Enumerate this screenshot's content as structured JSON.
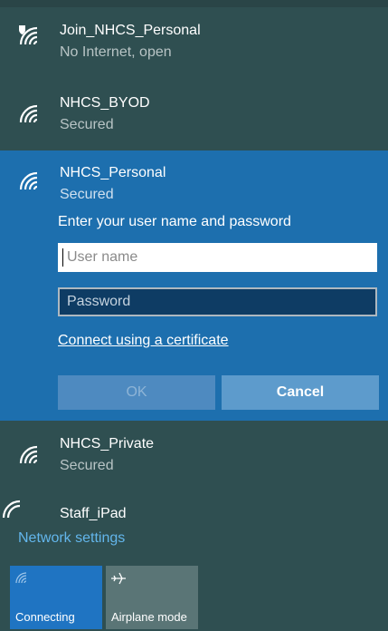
{
  "networks": [
    {
      "name": "Join_NHCS_Personal",
      "status": "No Internet, open",
      "icon": "wifi-shield-icon"
    },
    {
      "name": "NHCS_BYOD",
      "status": "Secured",
      "icon": "wifi-icon"
    },
    {
      "name": "NHCS_Personal",
      "status": "Secured",
      "icon": "wifi-icon"
    },
    {
      "name": "NHCS_Private",
      "status": "Secured",
      "icon": "wifi-icon"
    },
    {
      "name": "Staff_iPad",
      "status": "",
      "icon": "wifi-icon"
    }
  ],
  "login": {
    "prompt": "Enter your user name and password",
    "username_placeholder": "User name",
    "username_value": "",
    "password_placeholder": "Password",
    "password_value": "",
    "cert_link": "Connect using a certificate",
    "ok_label": "OK",
    "cancel_label": "Cancel"
  },
  "footer": {
    "settings_link": "Network settings",
    "tiles": [
      {
        "label": "Connecting",
        "icon": "wifi-icon",
        "active": true
      },
      {
        "label": "Airplane mode",
        "icon": "airplane-icon",
        "active": false
      }
    ]
  },
  "colors": {
    "panel_bg": "#2f4f51",
    "selected_bg": "#1d6fae",
    "link_blue": "#63b6ec",
    "active_tile": "#1f74c2",
    "inactive_tile": "#5a7576"
  }
}
